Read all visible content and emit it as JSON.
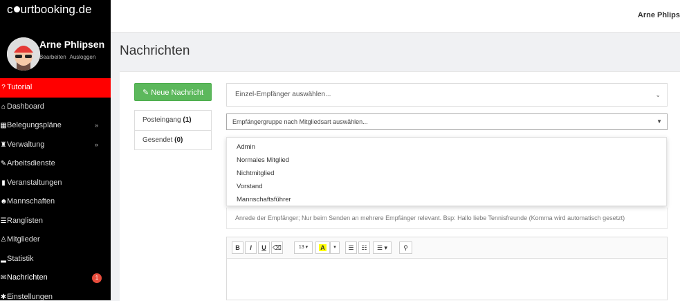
{
  "brand": {
    "prefix": "c",
    "suffix": "urtbooking.de"
  },
  "profile": {
    "name": "Arne Phlipsen",
    "edit": "Bearbeiten",
    "logout": "Ausloggen"
  },
  "sidebar": {
    "items": [
      {
        "icon": "question-icon",
        "glyph": "?",
        "label": "Tutorial"
      },
      {
        "icon": "dashboard-icon",
        "glyph": "⌂",
        "label": "Dashboard"
      },
      {
        "icon": "calendar-icon",
        "glyph": "▦",
        "label": "Belegungspläne",
        "chev": "»"
      },
      {
        "icon": "bank-icon",
        "glyph": "♜",
        "label": "Verwaltung",
        "chev": "»"
      },
      {
        "icon": "wrench-icon",
        "glyph": "✎",
        "label": "Arbeitsdienste"
      },
      {
        "icon": "book-icon",
        "glyph": "▮",
        "label": "Veranstaltungen"
      },
      {
        "icon": "users-icon",
        "glyph": "☻",
        "label": "Mannschaften"
      },
      {
        "icon": "list-icon",
        "glyph": "☰",
        "label": "Ranglisten"
      },
      {
        "icon": "user-icon",
        "glyph": "♙",
        "label": "Mitglieder"
      },
      {
        "icon": "chart-icon",
        "glyph": "▂",
        "label": "Statistik"
      },
      {
        "icon": "envelope-icon",
        "glyph": "✉",
        "label": "Nachrichten",
        "badge": "1"
      },
      {
        "icon": "gear-icon",
        "glyph": "✱",
        "label": "Einstellungen"
      }
    ]
  },
  "topbar": {
    "user": "Arne Phlips"
  },
  "page": {
    "title": "Nachrichten"
  },
  "compose": {
    "new_button": "Neue Nachricht"
  },
  "folders": [
    {
      "label": "Posteingang",
      "count": "(1)"
    },
    {
      "label": "Gesendet",
      "count": "(0)"
    }
  ],
  "form": {
    "recipient_placeholder": "Einzel-Empfänger auswählen...",
    "group_placeholder": "Empfängergruppe nach Mitgliedsart auswählen...",
    "group_options": [
      "Admin",
      "Normales Mitglied",
      "Nichtmitglied",
      "Vorstand",
      "Mannschaftsführer"
    ],
    "salutation_hint": "Anrede der Empfänger; Nur beim Senden an mehrere Empfänger relevant. Bsp: Hallo liebe Tennisfreunde (Komma wird automatisch gesetzt)"
  },
  "editor": {
    "toolbar": {
      "bold": "B",
      "italic": "I",
      "underline": "U",
      "eraser": "⌫",
      "font_size": "13 ▾",
      "color": "A",
      "color_caret": "▾",
      "ul": "☰",
      "ol": "☷",
      "align": "☰ ▾",
      "link": "⚲"
    }
  }
}
